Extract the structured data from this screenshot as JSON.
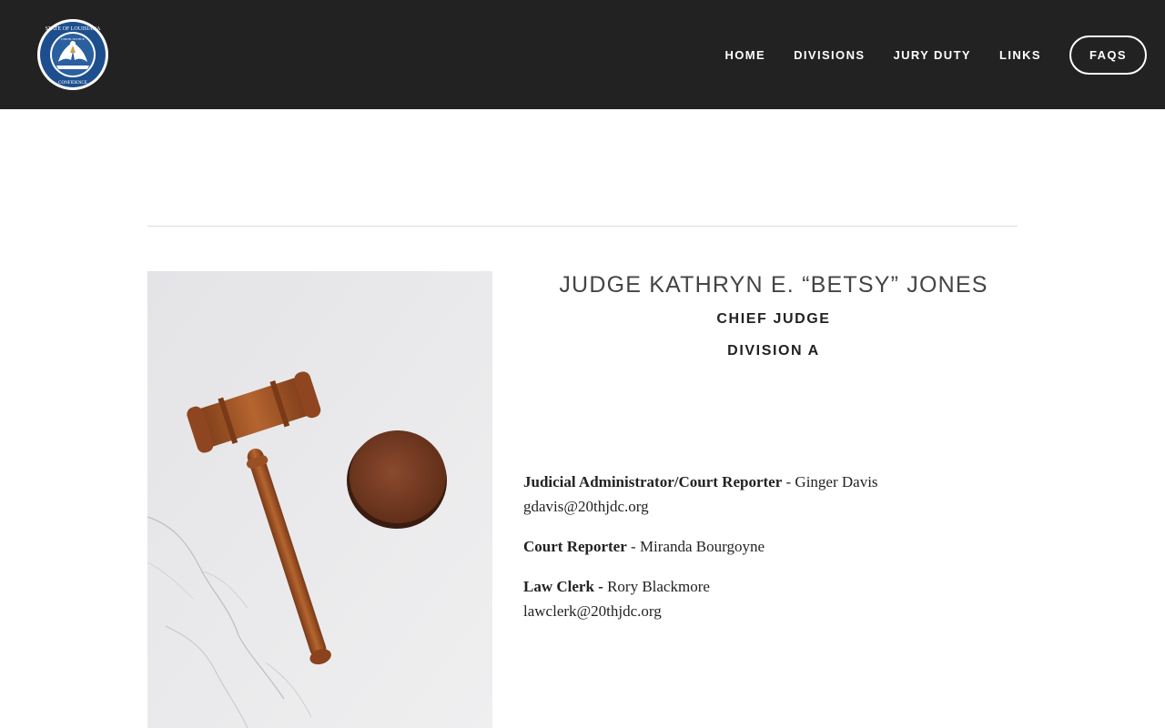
{
  "header": {
    "logo_icon": "louisiana-state-seal-icon",
    "logo_text": {
      "top": "STATE OF LOUISIANA",
      "inner": "UNION JUSTICE",
      "bottom": "CONFIDENCE"
    },
    "nav": [
      {
        "label": "HOME"
      },
      {
        "label": "DIVISIONS"
      },
      {
        "label": "JURY DUTY"
      },
      {
        "label": "LINKS"
      }
    ],
    "cta_label": "FAQS"
  },
  "judge": {
    "name": "JUDGE KATHRYN E. “BETSY” JONES",
    "title": "CHIEF JUDGE",
    "division": "DIVISION A"
  },
  "staff": [
    {
      "role": "Judicial Administrator/Court Reporter",
      "separator": " - ",
      "name": "Ginger Davis",
      "email": "gdavis@20thjdc.org"
    },
    {
      "role": "Court Reporter",
      "separator": " - ",
      "name": "Miranda Bourgoyne",
      "email": ""
    },
    {
      "role": "Law Clerk -",
      "separator": " ",
      "name": "Rory Blackmore",
      "email": "lawclerk@20thjdc.org"
    }
  ],
  "colors": {
    "header_bg": "#222222",
    "seal_blue": "#1d4f8e"
  },
  "photo_icon": "gavel-photo"
}
